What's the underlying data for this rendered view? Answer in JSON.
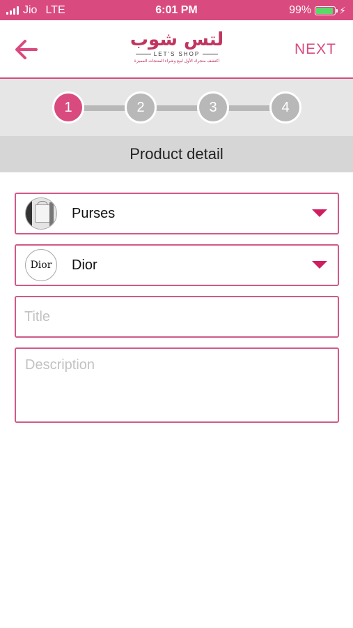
{
  "status_bar": {
    "carrier": "Jio",
    "network": "LTE",
    "time": "6:01 PM",
    "battery": "99%",
    "battery_level": 0.99
  },
  "nav": {
    "next_label": "NEXT",
    "logo_arabic": "لتس شوب",
    "logo_english": "LET'S SHOP",
    "logo_tagline": "اكتشف متجرك الأول لبيع وشراء المنتجات المميزة"
  },
  "stepper": {
    "steps": [
      "1",
      "2",
      "3",
      "4"
    ],
    "active_step": 1
  },
  "section": {
    "title": "Product detail"
  },
  "form": {
    "category": {
      "value": "Purses",
      "icon": "purse-image"
    },
    "brand": {
      "value": "Dior",
      "logo_text": "Dior"
    },
    "title": {
      "value": "",
      "placeholder": "Title"
    },
    "description": {
      "value": "",
      "placeholder": "Description"
    }
  },
  "colors": {
    "accent": "#d94a7e",
    "border": "#cf5a88",
    "step_inactive": "#b8b8b8"
  }
}
